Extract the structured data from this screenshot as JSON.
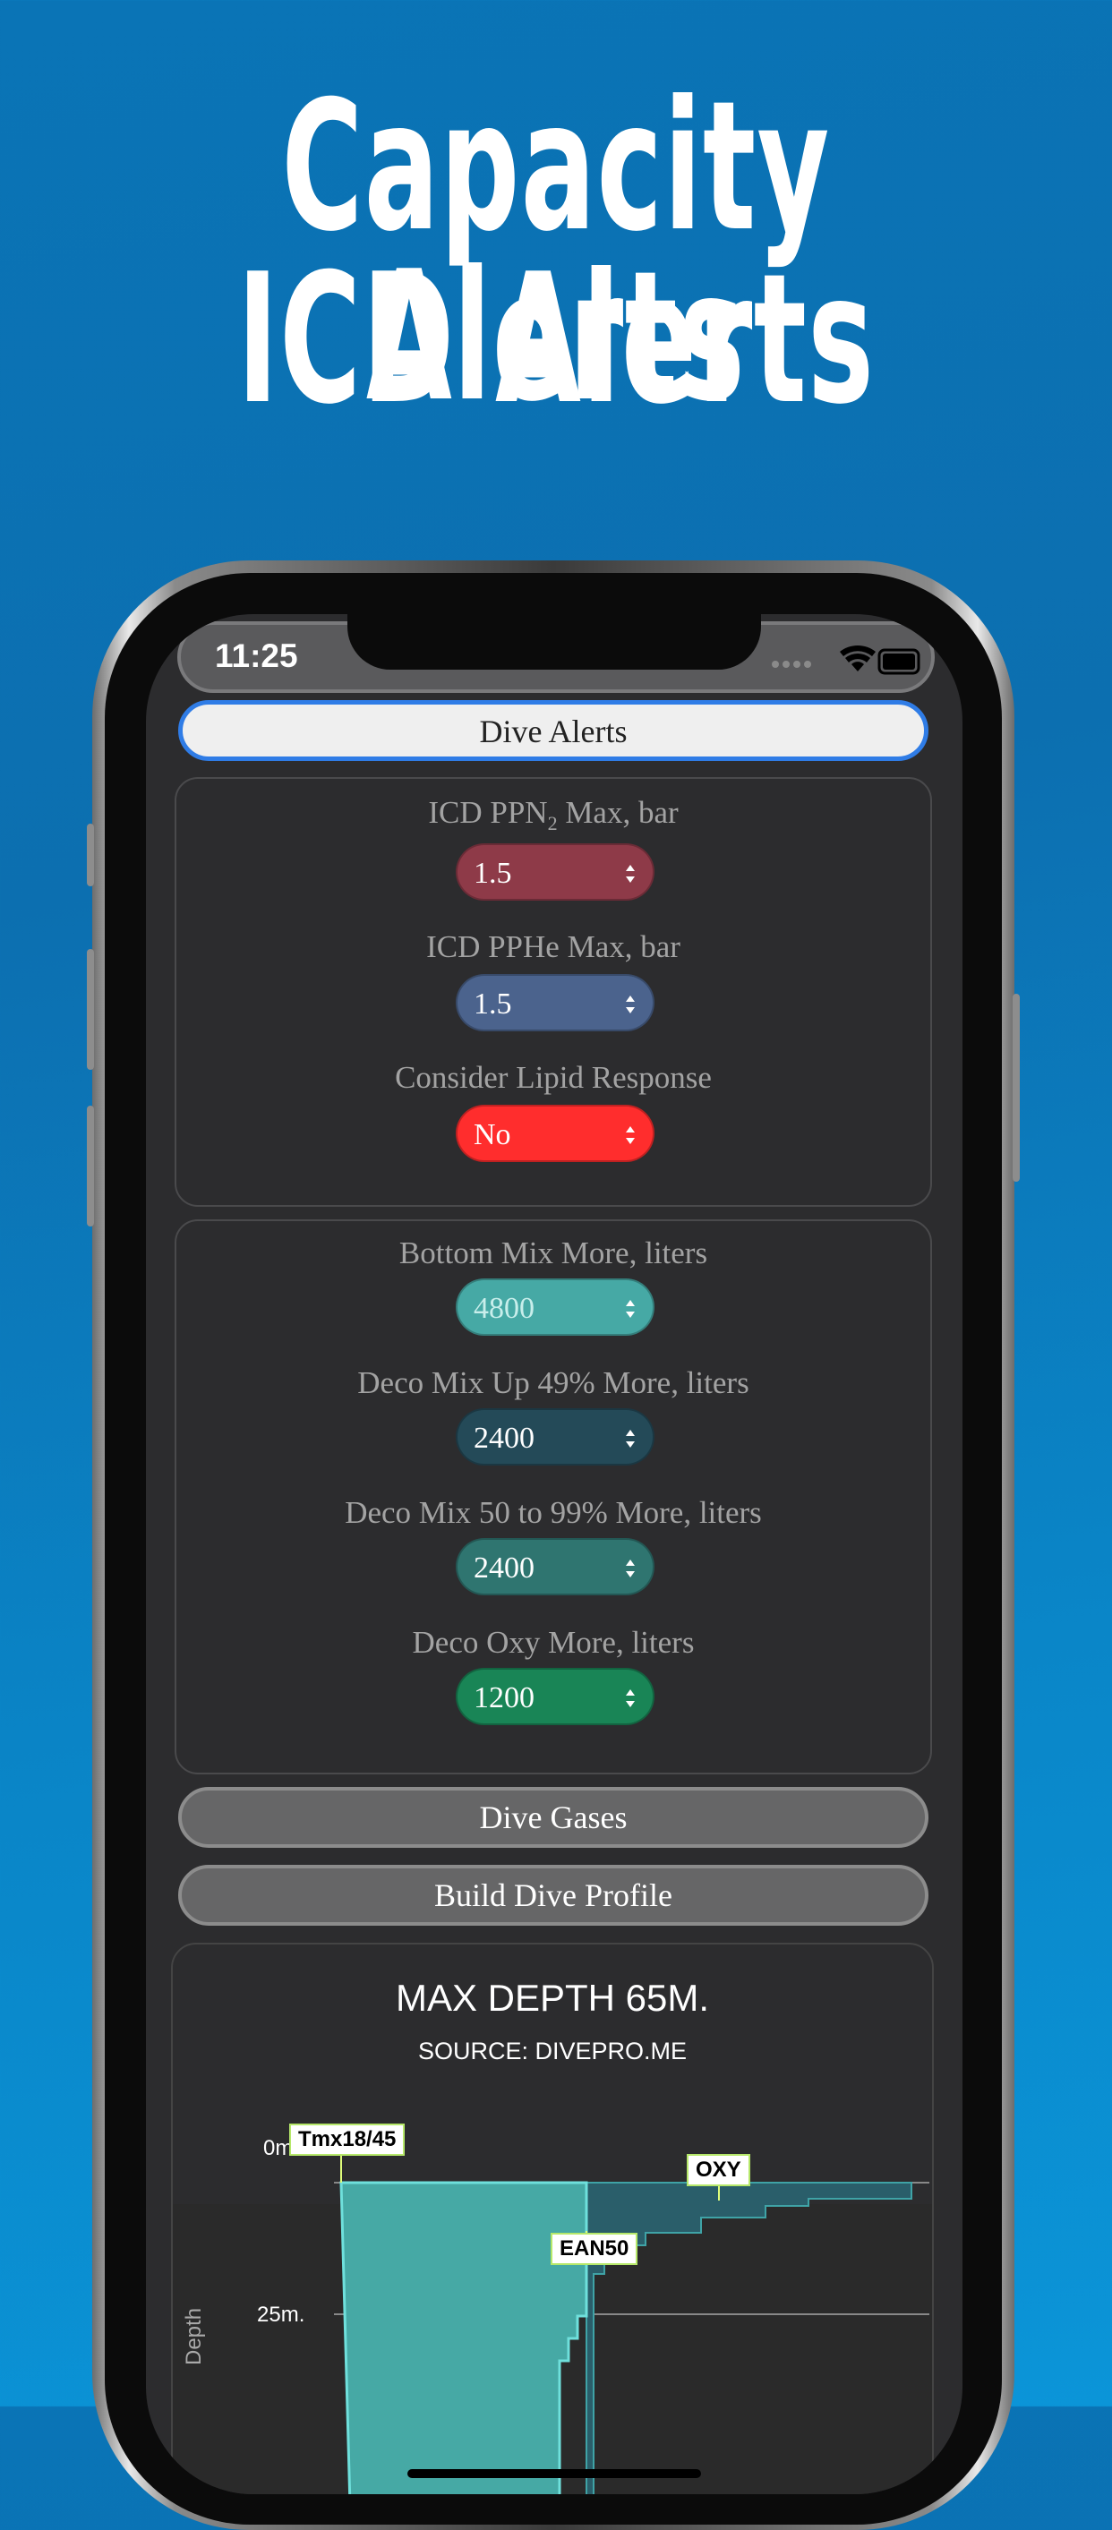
{
  "headline": {
    "line1": "Capacity Alerts",
    "line2": "ICD Alerts"
  },
  "status": {
    "time": "11:25"
  },
  "alerts_button": "Dive Alerts",
  "icd_panel": {
    "ppn2_label_a": "ICD PPN",
    "ppn2_label_sub": "2",
    "ppn2_label_b": " Max, bar",
    "ppn2_value": "1.5",
    "pphe_label": "ICD PPHe Max, bar",
    "pphe_value": "1.5",
    "lipid_label": "Consider Lipid Response",
    "lipid_value": "No"
  },
  "capacity_panel": {
    "bottom_label": "Bottom Mix More, liters",
    "bottom_value": "4800",
    "deco49_label": "Deco Mix Up 49% More, liters",
    "deco49_value": "2400",
    "deco50_label": "Deco Mix 50 to 99% More, liters",
    "deco50_value": "2400",
    "oxy_label": "Deco Oxy More, liters",
    "oxy_value": "1200"
  },
  "buttons": {
    "gases": "Dive Gases",
    "profile": "Build Dive Profile"
  },
  "colors": {
    "ppn2": "#8e3a48",
    "pphe": "#4b638d",
    "lipid": "#ff2d2d",
    "bottom": "#46a9a5",
    "deco49": "#244a58",
    "deco50": "#2f7570",
    "oxy": "#198556"
  },
  "chart_data": {
    "type": "area",
    "title": "MAX DEPTH 65M.",
    "subtitle": "SOURCE: DIVEPRO.ME",
    "ylabel": "Depth",
    "y_ticks": [
      "0m.",
      "25m."
    ],
    "gas_labels": [
      "Tmx18/45",
      "EAN50",
      "OXY"
    ]
  }
}
